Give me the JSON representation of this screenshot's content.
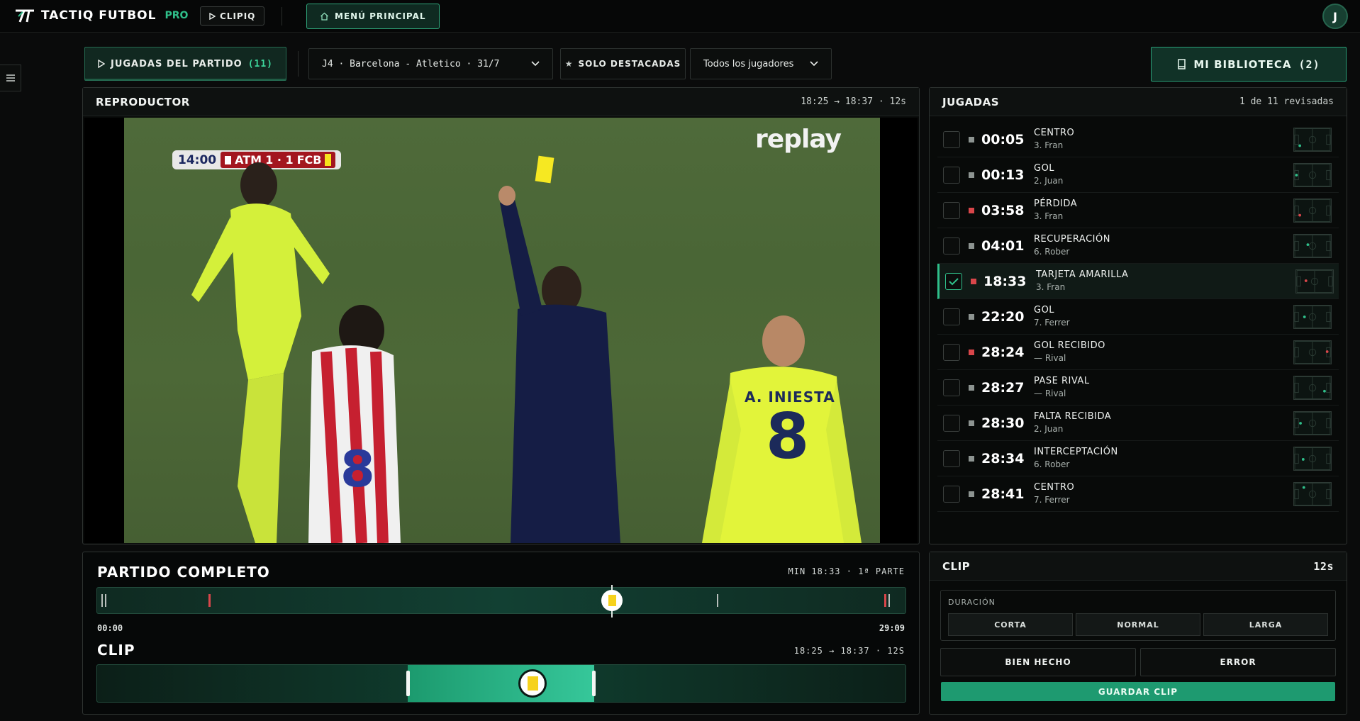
{
  "app": {
    "name": "TACTIQ FUTBOL",
    "tier": "PRO",
    "clipiq_label": "CLIPIQ",
    "menu_label": "MENÚ PRINCIPAL",
    "user_initial": "J"
  },
  "filters": {
    "jugadas_label": "JUGADAS DEL PARTIDO",
    "jugadas_count": "(11)",
    "match": "J4 · Barcelona - Atletico · 31/7",
    "destacadas_label": "SOLO DESTACADAS",
    "players": "Todos los jugadores",
    "biblioteca_label": "MI BIBLIOTECA",
    "biblioteca_count": "(2)"
  },
  "player": {
    "title": "REPRODUCTOR",
    "range": "18:25 → 18:37 · 12s",
    "scorebug": {
      "clock": "14:00",
      "home": "ATM",
      "score": "1 · 1",
      "away": "FCB"
    },
    "watermark": "replay",
    "jersey_name": "A. INIESTA",
    "jersey_number": "8"
  },
  "timeline": {
    "title": "PARTIDO COMPLETO",
    "meta": "MIN 18:33 · 1ª PARTE",
    "start": "00:00",
    "end": "29:09",
    "clip_title": "CLIP",
    "clip_meta": "18:25 → 18:37 · 12S"
  },
  "plays": {
    "title": "JUGADAS",
    "meta": "1 de 11 revisadas",
    "items": [
      {
        "time": "00:05",
        "type": "CENTRO",
        "player": "3. Fran",
        "dot": "#8d9491",
        "checked": false
      },
      {
        "time": "00:13",
        "type": "GOL",
        "player": "2. Juan",
        "dot": "#8d9491",
        "checked": false
      },
      {
        "time": "03:58",
        "type": "PÉRDIDA",
        "player": "3. Fran",
        "dot": "#d9464a",
        "checked": false
      },
      {
        "time": "04:01",
        "type": "RECUPERACIÓN",
        "player": "6. Rober",
        "dot": "#8d9491",
        "checked": false
      },
      {
        "time": "18:33",
        "type": "TARJETA AMARILLA",
        "player": "3. Fran",
        "dot": "#d9464a",
        "checked": true
      },
      {
        "time": "22:20",
        "type": "GOL",
        "player": "7. Ferrer",
        "dot": "#8d9491",
        "checked": false
      },
      {
        "time": "28:24",
        "type": "GOL RECIBIDO",
        "player": "— Rival",
        "dot": "#d9464a",
        "checked": false
      },
      {
        "time": "28:27",
        "type": "PASE RIVAL",
        "player": "— Rival",
        "dot": "#8d9491",
        "checked": false
      },
      {
        "time": "28:30",
        "type": "FALTA RECIBIDA",
        "player": "2. Juan",
        "dot": "#8d9491",
        "checked": false
      },
      {
        "time": "28:34",
        "type": "INTERCEPTACIÓN",
        "player": "6. Rober",
        "dot": "#8d9491",
        "checked": false
      },
      {
        "time": "28:41",
        "type": "CENTRO",
        "player": "7. Ferrer",
        "dot": "#8d9491",
        "checked": false
      }
    ]
  },
  "clip": {
    "title": "CLIP",
    "duration_value": "12s",
    "duration_label": "DURACIÓN",
    "options": [
      "CORTA",
      "NORMAL",
      "LARGA"
    ],
    "good_label": "BIEN HECHO",
    "error_label": "ERROR",
    "save_label": "GUARDAR CLIP"
  },
  "colors": {
    "accent": "#2fbf8a",
    "negative": "#d9464a",
    "card": "#f6d21c"
  }
}
